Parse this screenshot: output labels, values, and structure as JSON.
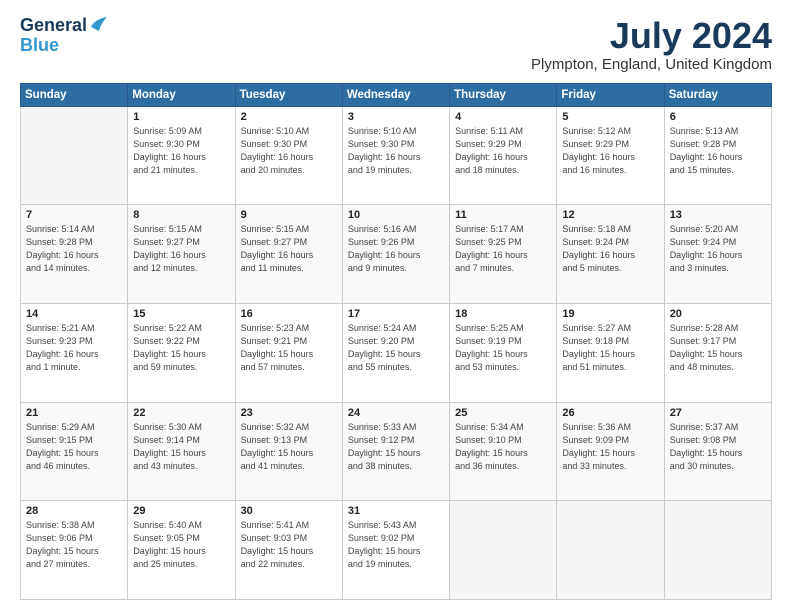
{
  "header": {
    "logo_line1": "General",
    "logo_line2": "Blue",
    "month_title": "July 2024",
    "location": "Plympton, England, United Kingdom"
  },
  "days_of_week": [
    "Sunday",
    "Monday",
    "Tuesday",
    "Wednesday",
    "Thursday",
    "Friday",
    "Saturday"
  ],
  "weeks": [
    [
      {
        "day": "",
        "info": ""
      },
      {
        "day": "1",
        "info": "Sunrise: 5:09 AM\nSunset: 9:30 PM\nDaylight: 16 hours\nand 21 minutes."
      },
      {
        "day": "2",
        "info": "Sunrise: 5:10 AM\nSunset: 9:30 PM\nDaylight: 16 hours\nand 20 minutes."
      },
      {
        "day": "3",
        "info": "Sunrise: 5:10 AM\nSunset: 9:30 PM\nDaylight: 16 hours\nand 19 minutes."
      },
      {
        "day": "4",
        "info": "Sunrise: 5:11 AM\nSunset: 9:29 PM\nDaylight: 16 hours\nand 18 minutes."
      },
      {
        "day": "5",
        "info": "Sunrise: 5:12 AM\nSunset: 9:29 PM\nDaylight: 16 hours\nand 16 minutes."
      },
      {
        "day": "6",
        "info": "Sunrise: 5:13 AM\nSunset: 9:28 PM\nDaylight: 16 hours\nand 15 minutes."
      }
    ],
    [
      {
        "day": "7",
        "info": "Sunrise: 5:14 AM\nSunset: 9:28 PM\nDaylight: 16 hours\nand 14 minutes."
      },
      {
        "day": "8",
        "info": "Sunrise: 5:15 AM\nSunset: 9:27 PM\nDaylight: 16 hours\nand 12 minutes."
      },
      {
        "day": "9",
        "info": "Sunrise: 5:15 AM\nSunset: 9:27 PM\nDaylight: 16 hours\nand 11 minutes."
      },
      {
        "day": "10",
        "info": "Sunrise: 5:16 AM\nSunset: 9:26 PM\nDaylight: 16 hours\nand 9 minutes."
      },
      {
        "day": "11",
        "info": "Sunrise: 5:17 AM\nSunset: 9:25 PM\nDaylight: 16 hours\nand 7 minutes."
      },
      {
        "day": "12",
        "info": "Sunrise: 5:18 AM\nSunset: 9:24 PM\nDaylight: 16 hours\nand 5 minutes."
      },
      {
        "day": "13",
        "info": "Sunrise: 5:20 AM\nSunset: 9:24 PM\nDaylight: 16 hours\nand 3 minutes."
      }
    ],
    [
      {
        "day": "14",
        "info": "Sunrise: 5:21 AM\nSunset: 9:23 PM\nDaylight: 16 hours\nand 1 minute."
      },
      {
        "day": "15",
        "info": "Sunrise: 5:22 AM\nSunset: 9:22 PM\nDaylight: 15 hours\nand 59 minutes."
      },
      {
        "day": "16",
        "info": "Sunrise: 5:23 AM\nSunset: 9:21 PM\nDaylight: 15 hours\nand 57 minutes."
      },
      {
        "day": "17",
        "info": "Sunrise: 5:24 AM\nSunset: 9:20 PM\nDaylight: 15 hours\nand 55 minutes."
      },
      {
        "day": "18",
        "info": "Sunrise: 5:25 AM\nSunset: 9:19 PM\nDaylight: 15 hours\nand 53 minutes."
      },
      {
        "day": "19",
        "info": "Sunrise: 5:27 AM\nSunset: 9:18 PM\nDaylight: 15 hours\nand 51 minutes."
      },
      {
        "day": "20",
        "info": "Sunrise: 5:28 AM\nSunset: 9:17 PM\nDaylight: 15 hours\nand 48 minutes."
      }
    ],
    [
      {
        "day": "21",
        "info": "Sunrise: 5:29 AM\nSunset: 9:15 PM\nDaylight: 15 hours\nand 46 minutes."
      },
      {
        "day": "22",
        "info": "Sunrise: 5:30 AM\nSunset: 9:14 PM\nDaylight: 15 hours\nand 43 minutes."
      },
      {
        "day": "23",
        "info": "Sunrise: 5:32 AM\nSunset: 9:13 PM\nDaylight: 15 hours\nand 41 minutes."
      },
      {
        "day": "24",
        "info": "Sunrise: 5:33 AM\nSunset: 9:12 PM\nDaylight: 15 hours\nand 38 minutes."
      },
      {
        "day": "25",
        "info": "Sunrise: 5:34 AM\nSunset: 9:10 PM\nDaylight: 15 hours\nand 36 minutes."
      },
      {
        "day": "26",
        "info": "Sunrise: 5:36 AM\nSunset: 9:09 PM\nDaylight: 15 hours\nand 33 minutes."
      },
      {
        "day": "27",
        "info": "Sunrise: 5:37 AM\nSunset: 9:08 PM\nDaylight: 15 hours\nand 30 minutes."
      }
    ],
    [
      {
        "day": "28",
        "info": "Sunrise: 5:38 AM\nSunset: 9:06 PM\nDaylight: 15 hours\nand 27 minutes."
      },
      {
        "day": "29",
        "info": "Sunrise: 5:40 AM\nSunset: 9:05 PM\nDaylight: 15 hours\nand 25 minutes."
      },
      {
        "day": "30",
        "info": "Sunrise: 5:41 AM\nSunset: 9:03 PM\nDaylight: 15 hours\nand 22 minutes."
      },
      {
        "day": "31",
        "info": "Sunrise: 5:43 AM\nSunset: 9:02 PM\nDaylight: 15 hours\nand 19 minutes."
      },
      {
        "day": "",
        "info": ""
      },
      {
        "day": "",
        "info": ""
      },
      {
        "day": "",
        "info": ""
      }
    ]
  ]
}
